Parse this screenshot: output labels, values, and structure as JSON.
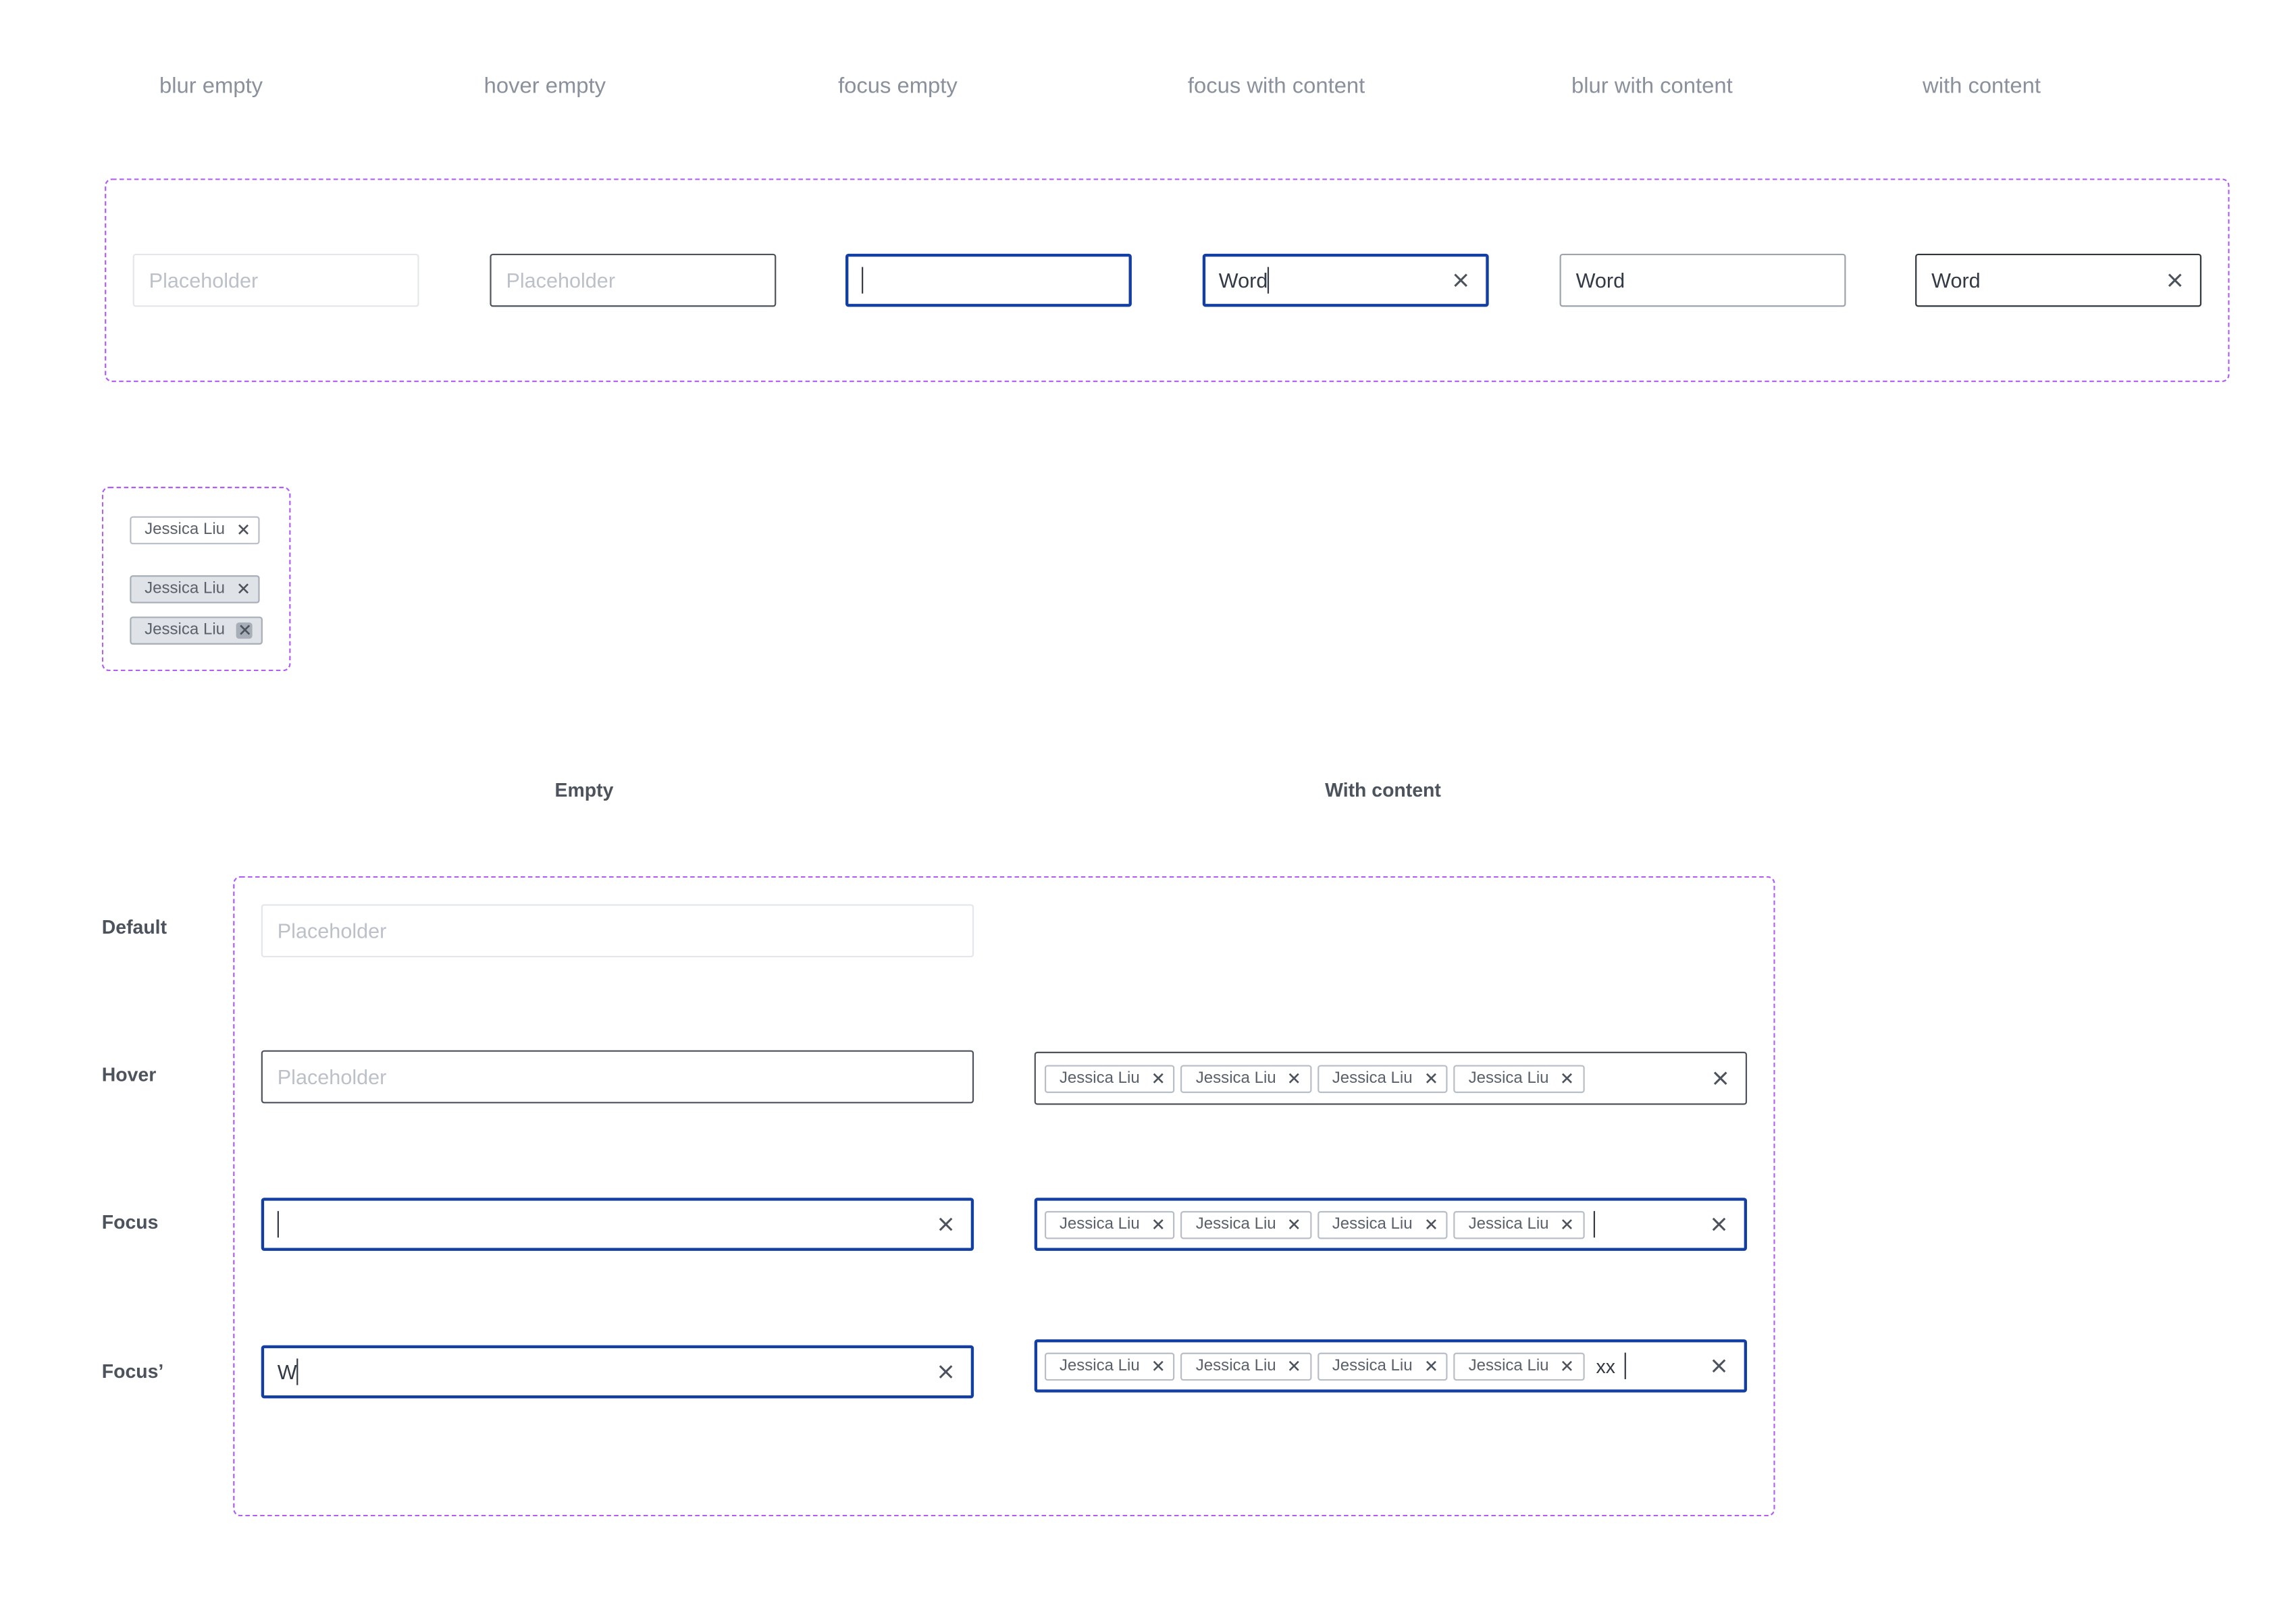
{
  "state_labels": [
    "blur empty",
    "hover empty",
    "focus empty",
    "focus with content",
    "blur with content",
    "with content"
  ],
  "inputs": {
    "placeholder": "Placeholder",
    "word": "Word",
    "typed_w": "W",
    "typed_xx": "xx"
  },
  "chip": {
    "name": "Jessica Liu"
  },
  "grid": {
    "col_empty": "Empty",
    "col_content": "With content",
    "rows": [
      "Default",
      "Hover",
      "Focus",
      "Focus’"
    ]
  },
  "colors": {
    "frame": "#b15cf4",
    "focus": "#123fa1",
    "hover_border": "#4d535c",
    "blur_border": "#e3e6ea",
    "chip_gray": "#dfe2e7"
  },
  "icons": {
    "clear": "close-icon",
    "chip_remove": "close-icon"
  }
}
